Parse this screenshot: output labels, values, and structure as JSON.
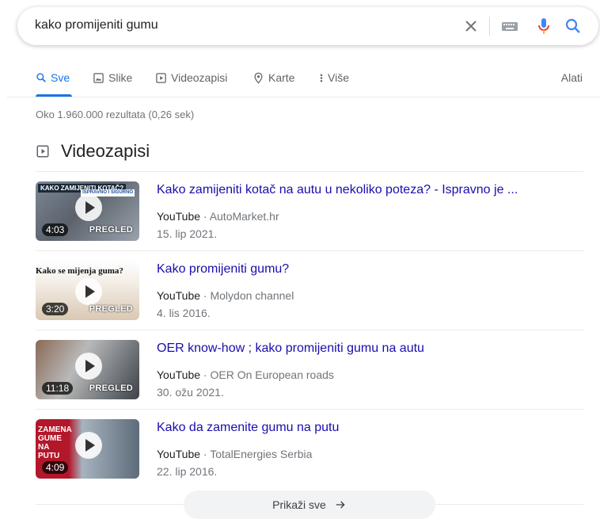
{
  "search": {
    "query": "kako promijeniti gumu",
    "icons": [
      "close-icon",
      "keyboard-icon",
      "microphone-icon",
      "search-icon"
    ],
    "colors": {
      "mic_blue": "#4285f4",
      "mic_red": "#ea4335",
      "accent": "#1a73e8",
      "link": "#1a0dab"
    }
  },
  "tabs": [
    {
      "label": "Sve",
      "icon": "search-icon",
      "active": true
    },
    {
      "label": "Slike",
      "icon": "image-icon"
    },
    {
      "label": "Videozapisi",
      "icon": "video-icon"
    },
    {
      "label": "Karte",
      "icon": "map-pin-icon"
    },
    {
      "label": "Više",
      "icon": "more-vert-icon"
    }
  ],
  "tools_label": "Alati",
  "stats": "Oko 1.960.000 rezultata (0,26 sek)",
  "section_title": "Videozapisi",
  "videos": [
    {
      "title": "Kako zamijeniti kotač na autu u nekoliko poteza? - Ispravno je ...",
      "platform": "YouTube",
      "channel": "AutoMarket.hr",
      "date": "15. lip 2021.",
      "duration": "4:03",
      "preview": "PREGLED",
      "thumb_text": "KAKO ZAMIJENITI KOTAČ?",
      "thumb_stamp": "ISPRAVNO I SIGURNO"
    },
    {
      "title": "Kako promijeniti gumu?",
      "platform": "YouTube",
      "channel": "Molydon channel",
      "date": "4. lis 2016.",
      "duration": "3:20",
      "preview": "PREGLED",
      "thumb_text": "Kako se mijenja guma?"
    },
    {
      "title": "OER know-how ; kako promijeniti gumu na autu",
      "platform": "YouTube",
      "channel": "OER On European roads",
      "date": "30. ožu 2021.",
      "duration": "11:18",
      "preview": "PREGLED"
    },
    {
      "title": "Kako da zamenite gumu na putu",
      "platform": "YouTube",
      "channel": "TotalEnergies Serbia",
      "date": "22. lip 2016.",
      "duration": "4:09",
      "thumb_text": "ZAMENA GUME NA PUTU"
    }
  ],
  "show_all_label": "Prikaži sve"
}
